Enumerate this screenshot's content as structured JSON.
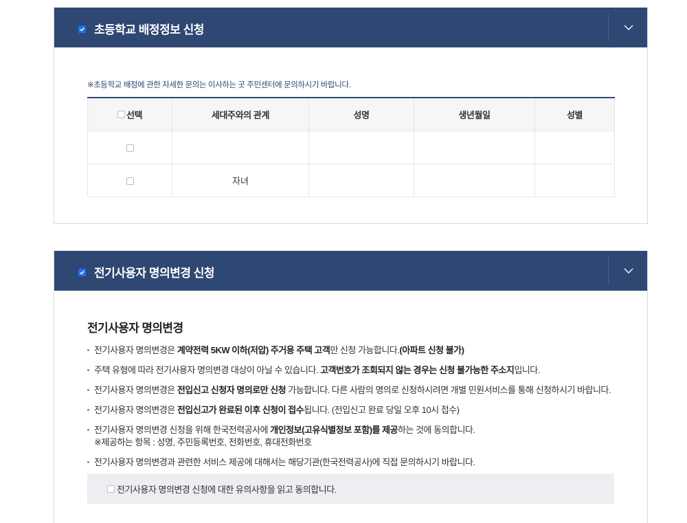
{
  "section1": {
    "title": "초등학교 배정정보 신청",
    "notice": "※초등학교 배정에 관한 자세한 문의는 이사하는 곳 주민센터에 문의하시기 바랍니다.",
    "table": {
      "headers": [
        "선택",
        "세대주와의 관계",
        "성명",
        "생년월일",
        "성별"
      ],
      "rows": [
        {
          "relation": "",
          "name": "",
          "birth": "",
          "gender": ""
        },
        {
          "relation": "자녀",
          "name": "",
          "birth": "",
          "gender": ""
        }
      ]
    }
  },
  "section2": {
    "title": "전기사용자 명의변경 신청",
    "heading": "전기사용자 명의변경",
    "bullets": [
      {
        "parts": [
          "전기사용자 명의변경은 ",
          "계약전력 5KW 이하(저압) 주거용 주택 고객",
          "만 신청 가능합니다.",
          "(아파트 신청 불가)"
        ]
      },
      {
        "parts": [
          "주택 유형에 따라 전기사용자 명의변경 대상이 아닐 수 있습니다. ",
          "고객번호가 조회되지 않는 경우는 신청 불가능한 주소지",
          "입니다."
        ]
      },
      {
        "parts": [
          "전기사용자 명의변경은 ",
          "전입신고 신청자 명의로만 신청",
          " 가능합니다. 다른 사람의 명의로 신청하시려면 개별 민원서비스를 통해 신청하시기 바랍니다."
        ]
      },
      {
        "parts": [
          "전기사용자 명의변경은 ",
          "전입신고가 완료된 이후 신청이 접수",
          "됩니다. (전입신고 완료 당일 오후 10시 접수)"
        ]
      },
      {
        "parts": [
          "전기사용자 명의변경 신청을 위해 한국전력공사에 ",
          "개인정보(고유식별정보 포함)를 제공",
          "하는 것에 동의합니다."
        ],
        "sub": "※제공하는 항목 : 성명, 주민등록번호, 전화번호, 휴대전화번호"
      },
      {
        "parts": [
          "전기사용자 명의변경과 관련한 서비스 제공에 대해서는 해당기관(한국전력공사)에 직접 문의하시기 바랍니다."
        ]
      }
    ],
    "agree_label": "전기사용자 명의변경 신청에 대한 유의사항을 읽고 동의합니다."
  },
  "colors": {
    "header_bg": "#2f4773",
    "accent_check": "#1a73e8"
  },
  "icons": {
    "section_checkbox": "checked-checkbox-icon",
    "toggle": "chevron-down-icon"
  }
}
